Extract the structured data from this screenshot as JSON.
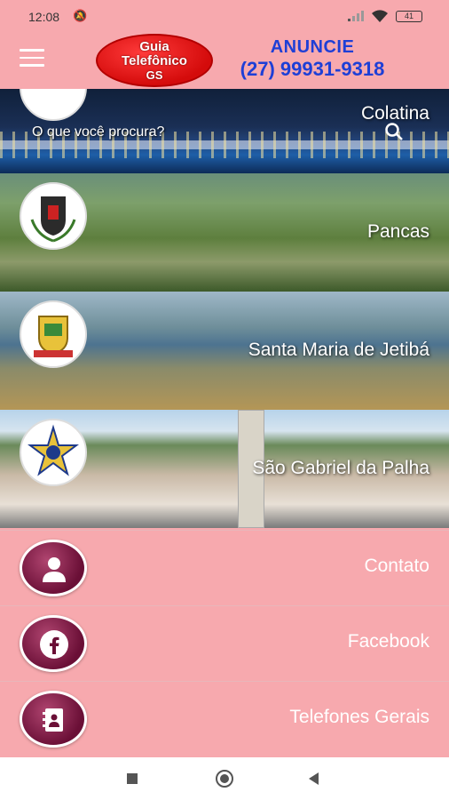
{
  "status_bar": {
    "time": "12:08",
    "battery": "41"
  },
  "header": {
    "logo": {
      "line1": "Guia",
      "line2": "Telefônico",
      "line3": "GS"
    },
    "ad_title": "ANUNCIE",
    "ad_phone": "(27) 99931-9318"
  },
  "search": {
    "placeholder": "O que você procura?"
  },
  "cities": [
    {
      "name": "Colatina"
    },
    {
      "name": "Pancas"
    },
    {
      "name": "Santa Maria de Jetibá"
    },
    {
      "name": "São Gabriel da Palha"
    }
  ],
  "menu": [
    {
      "label": "Contato",
      "icon": "contact-user-icon"
    },
    {
      "label": "Facebook",
      "icon": "facebook-icon"
    },
    {
      "label": "Telefones Gerais",
      "icon": "phonebook-icon"
    }
  ],
  "colors": {
    "background": "#f7a9ae",
    "accent": "#1e3fd6",
    "button": "#6a0f36"
  }
}
